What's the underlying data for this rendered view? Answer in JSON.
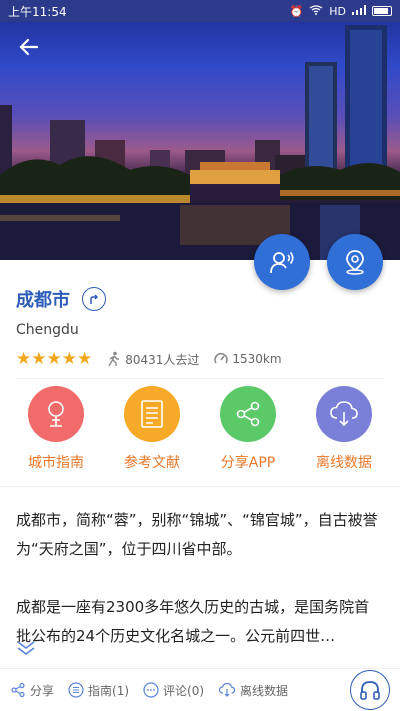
{
  "status_bar": {
    "time": "上午11:54",
    "network": "HD",
    "signal": "4G"
  },
  "city": {
    "name": "成都市",
    "pinyin": "Chengdu",
    "rating_stars": "★★★★★",
    "rating_value": 5,
    "visitors": "80431人去过",
    "distance": "1530km"
  },
  "actions": [
    {
      "label": "城市指南",
      "color": "#f26b6b",
      "icon": "city-guide-icon"
    },
    {
      "label": "参考文献",
      "color": "#f7a928",
      "icon": "document-icon"
    },
    {
      "label": "分享APP",
      "color": "#5bc967",
      "icon": "share-icon"
    },
    {
      "label": "离线数据",
      "color": "#7a7fd8",
      "icon": "cloud-download-icon"
    }
  ],
  "description": {
    "paragraph1": "成都市，简称“蓉”，别称“锦城”、“锦官城”，自古被誉为“天府之国”，位于四川省中部。",
    "paragraph2": "成都是一座有2300多年悠久历史的古城，是国务院首批公布的24个历史文化名城之一。公元前四世…"
  },
  "bottom_bar": {
    "share": "分享",
    "guide": "指南(1)",
    "comments": "评论(0)",
    "offline": "离线数据"
  },
  "colors": {
    "accent_blue": "#2d5db8",
    "orange_label": "#e8782a",
    "star": "#f2a81d"
  }
}
